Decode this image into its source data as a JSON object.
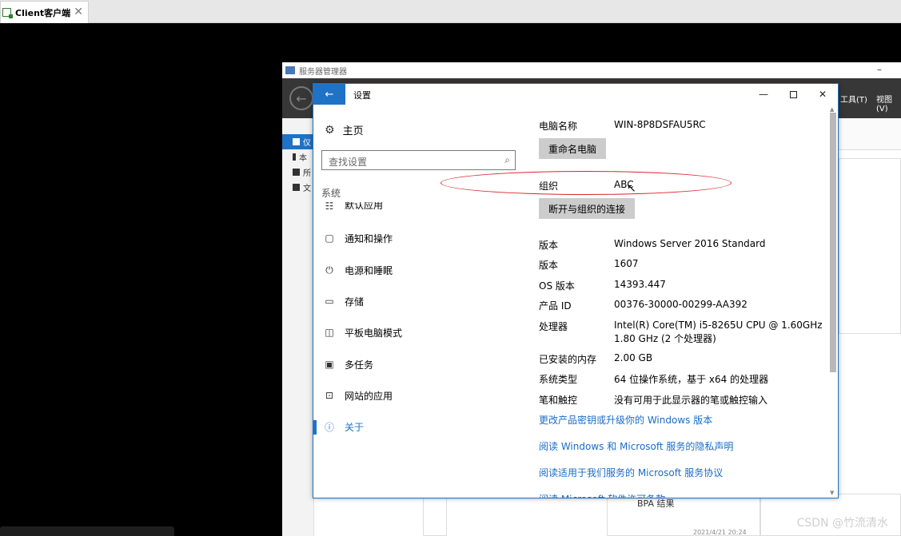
{
  "host": {
    "tab_label": "Client客户端",
    "close_glyph": "✕"
  },
  "server_manager": {
    "title": "服务器管理器",
    "min_glyph": "–",
    "menu_tools": "工具(T)",
    "menu_view": "视图(V)",
    "nav_items": [
      "仪",
      "本",
      "所",
      "文"
    ],
    "bpa_label": "BPA 结果",
    "timestamp": "2021/4/21 20:24"
  },
  "settings": {
    "title": "设置",
    "back_glyph": "←",
    "min_glyph": "—",
    "close_glyph": "✕",
    "home_label": "主页",
    "search_placeholder": "查找设置",
    "section_label": "系统",
    "nav": [
      {
        "icon": "default-apps-icon",
        "glyph": "☷",
        "label": "默认应用"
      },
      {
        "icon": "notification-icon",
        "glyph": "▢",
        "label": "通知和操作"
      },
      {
        "icon": "power-icon",
        "glyph": "⏻",
        "label": "电源和睡眠"
      },
      {
        "icon": "storage-icon",
        "glyph": "▭",
        "label": "存储"
      },
      {
        "icon": "tablet-icon",
        "glyph": "◫",
        "label": "平板电脑模式"
      },
      {
        "icon": "multitask-icon",
        "glyph": "▣",
        "label": "多任务"
      },
      {
        "icon": "web-apps-icon",
        "glyph": "⊡",
        "label": "网站的应用"
      },
      {
        "icon": "info-icon",
        "glyph": "ⓘ",
        "label": "关于"
      }
    ],
    "about": {
      "pc_name_key": "电脑名称",
      "pc_name_value": "WIN-8P8DSFAU5RC",
      "rename_button": "重命名电脑",
      "org_key": "组织",
      "org_value": "ABC",
      "disconnect_button": "断开与组织的连接",
      "specs": [
        {
          "k": "版本",
          "v": "Windows Server 2016 Standard"
        },
        {
          "k": "版本",
          "v": "1607"
        },
        {
          "k": "OS 版本",
          "v": "14393.447"
        },
        {
          "k": "产品 ID",
          "v": "00376-30000-00299-AA392"
        },
        {
          "k": "处理器",
          "v": "Intel(R) Core(TM) i5-8265U CPU @ 1.60GHz",
          "v2": "1.80 GHz  (2 个处理器)"
        },
        {
          "k": "已安装的内存",
          "v": "2.00 GB"
        },
        {
          "k": "系统类型",
          "v": "64 位操作系统，基于 x64 的处理器"
        },
        {
          "k": "笔和触控",
          "v": "没有可用于此显示器的笔或触控输入"
        }
      ],
      "links": [
        "更改产品密钥或升级你的 Windows 版本",
        "阅读 Windows 和 Microsoft 服务的隐私声明",
        "阅读适用于我们服务的 Microsoft 服务协议",
        "阅读 Microsoft 软件许可条款"
      ]
    }
  },
  "watermark": "CSDN @竹流清水",
  "colors": {
    "accent": "#1f72c6",
    "annotation": "#d9262c",
    "link": "#1a6cc6"
  }
}
